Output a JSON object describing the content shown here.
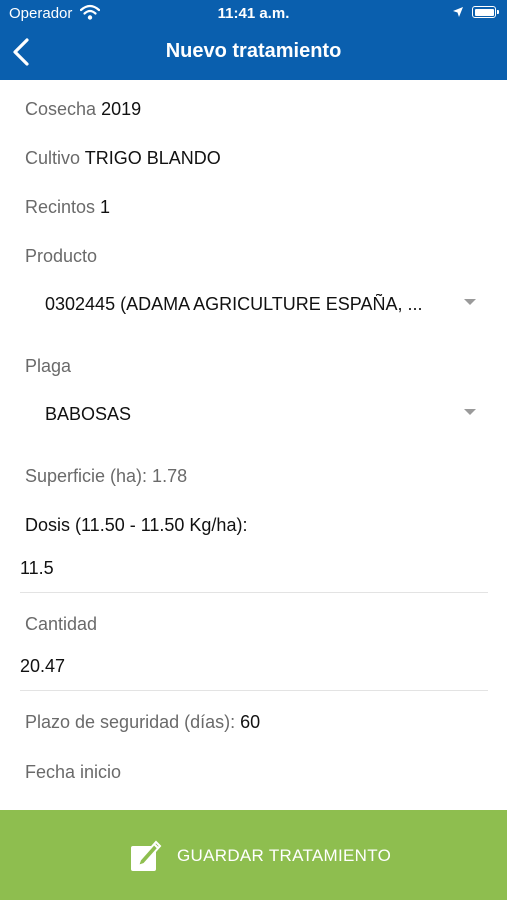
{
  "status_bar": {
    "carrier": "Operador",
    "time": "11:41 a.m."
  },
  "nav": {
    "title": "Nuevo tratamiento",
    "back_icon": "chevron-left-icon"
  },
  "form": {
    "cosecha": {
      "label": "Cosecha",
      "value": "2019"
    },
    "cultivo": {
      "label": "Cultivo",
      "value": "TRIGO BLANDO"
    },
    "recintos": {
      "label": "Recintos",
      "value": "1"
    },
    "producto": {
      "label": "Producto",
      "selected": "0302445 (ADAMA AGRICULTURE ESPAÑA, ..."
    },
    "plaga": {
      "label": "Plaga",
      "selected": "BABOSAS"
    },
    "superficie": {
      "label": "Superficie (ha): 1.78"
    },
    "dosis": {
      "label": "Dosis (11.50 - 11.50 Kg/ha):",
      "value": "11.5"
    },
    "cantidad": {
      "label": "Cantidad",
      "value": "20.47"
    },
    "plazo": {
      "label": "Plazo de seguridad (días):",
      "value": "60"
    },
    "fecha_inicio": {
      "label": "Fecha inicio"
    }
  },
  "footer": {
    "save_label": "GUARDAR TRATAMIENTO",
    "save_icon": "edit-icon"
  },
  "colors": {
    "header_bg": "#0a5fae",
    "footer_bg": "#8ebe4f"
  }
}
